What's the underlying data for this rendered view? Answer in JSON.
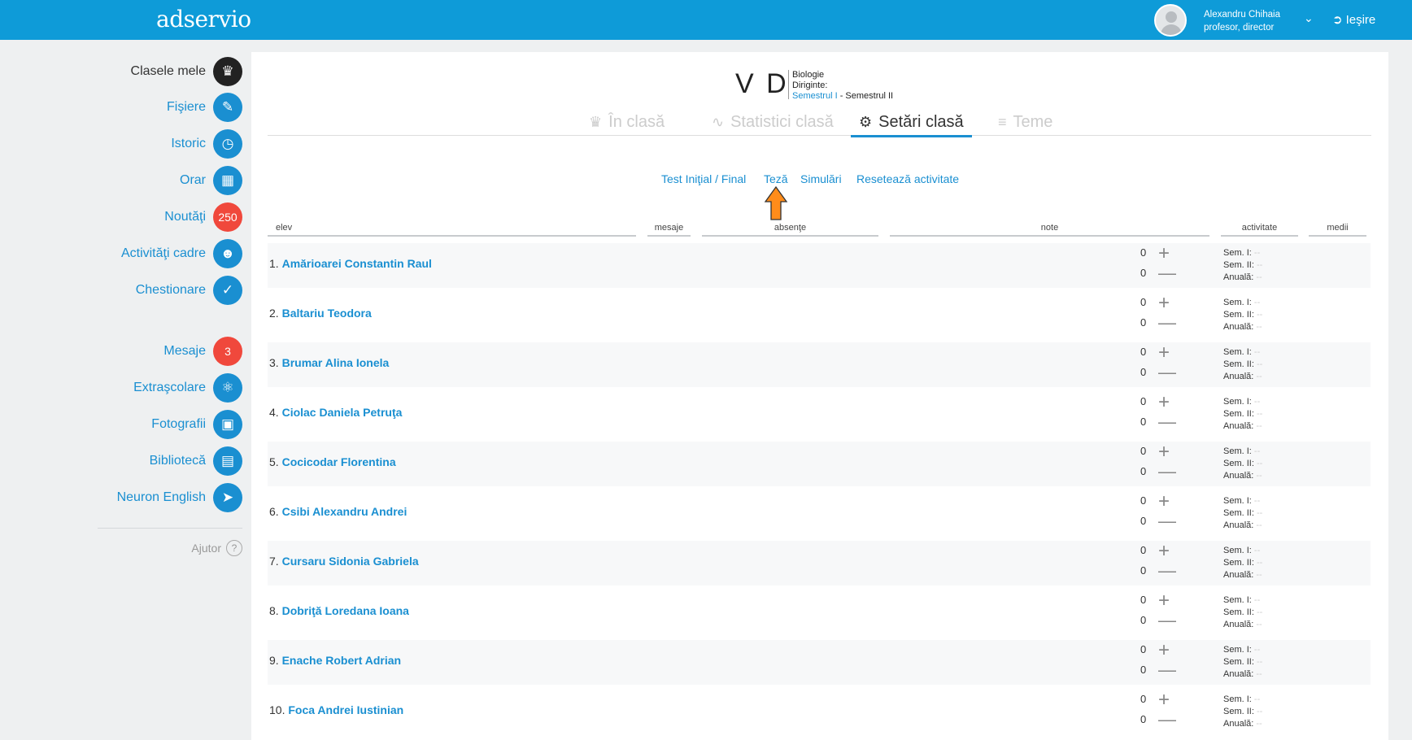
{
  "app": {
    "logo": "adservio"
  },
  "user": {
    "name": "Alexandru Chihaia",
    "role": "profesor, director",
    "logout_label": "Ieşire"
  },
  "sidebar": {
    "items": [
      {
        "label": "Clasele mele",
        "icon": "class-icon"
      },
      {
        "label": "Fişiere",
        "icon": "paperclip-icon"
      },
      {
        "label": "Istoric",
        "icon": "history-icon"
      },
      {
        "label": "Orar",
        "icon": "calendar-icon"
      },
      {
        "label": "Noutăţi",
        "badge": "250"
      },
      {
        "label": "Activităţi cadre",
        "icon": "staff-icon"
      },
      {
        "label": "Chestionare",
        "icon": "survey-icon"
      },
      {
        "label": "Mesaje",
        "badge": "3"
      },
      {
        "label": "Extraşcolare",
        "icon": "activities-icon"
      },
      {
        "label": "Fotografii",
        "icon": "photos-icon"
      },
      {
        "label": "Bibliotecă",
        "icon": "library-icon"
      },
      {
        "label": "Neuron English",
        "icon": "paper-plane-icon"
      }
    ],
    "help": "Ajutor"
  },
  "class": {
    "name": "V D",
    "subject": "Biologie",
    "diriginte": "Diriginte:",
    "semester1": "Semestrul I",
    "separator": " - ",
    "semester2": "Semestrul II"
  },
  "tabs": [
    {
      "label": "În clasă"
    },
    {
      "label": "Statistici clasă"
    },
    {
      "label": "Setări clasă"
    },
    {
      "label": "Teme"
    }
  ],
  "subnav": [
    "Test Iniţial / Final",
    "Teză",
    "Simulări",
    "Resetează activitate"
  ],
  "table": {
    "headers": {
      "elev": "elev",
      "mesaje": "mesaje",
      "absente": "absenţe",
      "note": "note",
      "activitate": "activitate",
      "medii": "medii"
    },
    "rows": [
      {
        "num": "1.",
        "name": "Amărioarei Constantin Raul",
        "act_plus": "0",
        "act_minus": "0"
      },
      {
        "num": "2.",
        "name": "Baltariu Teodora",
        "act_plus": "0",
        "act_minus": "0"
      },
      {
        "num": "3.",
        "name": "Brumar Alina Ionela",
        "act_plus": "0",
        "act_minus": "0"
      },
      {
        "num": "4.",
        "name": "Ciolac Daniela Petruţa",
        "act_plus": "0",
        "act_minus": "0"
      },
      {
        "num": "5.",
        "name": "Cocicodar Florentina",
        "act_plus": "0",
        "act_minus": "0"
      },
      {
        "num": "6.",
        "name": "Csibi Alexandru Andrei",
        "act_plus": "0",
        "act_minus": "0"
      },
      {
        "num": "7.",
        "name": "Cursaru Sidonia Gabriela",
        "act_plus": "0",
        "act_minus": "0"
      },
      {
        "num": "8.",
        "name": "Dobriţă Loredana Ioana",
        "act_plus": "0",
        "act_minus": "0"
      },
      {
        "num": "9.",
        "name": "Enache Robert Adrian",
        "act_plus": "0",
        "act_minus": "0"
      },
      {
        "num": "10.",
        "name": "Foca Andrei Iustinian",
        "act_plus": "0",
        "act_minus": "0"
      }
    ],
    "medii_labels": {
      "sem1": "Sem. I:",
      "sem2": "Sem. II:",
      "anual": "Anuală:",
      "empty": "--"
    }
  },
  "colors": {
    "brand": "#0e9bd8",
    "link": "#1a8fd1",
    "badge": "#f0483c",
    "arrow": "#ff8c1a"
  }
}
